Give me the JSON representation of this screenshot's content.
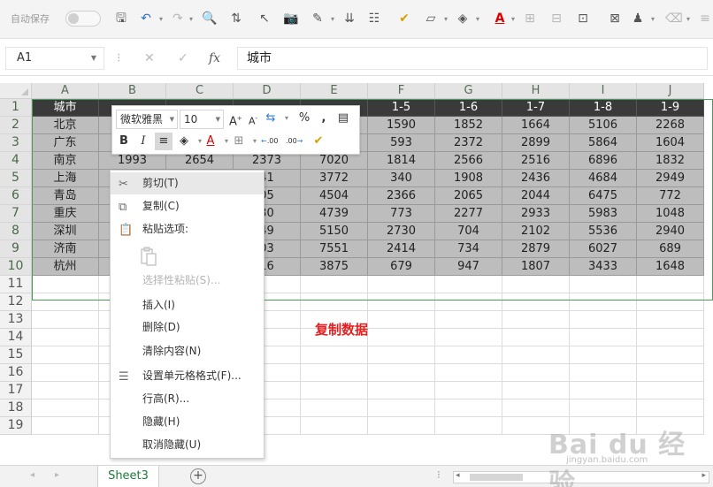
{
  "toolbar": {
    "autosave_label": "自动保存"
  },
  "formula_bar": {
    "name_box": "A1",
    "fx": "fx",
    "value": "城市"
  },
  "columns": [
    "A",
    "B",
    "C",
    "D",
    "E",
    "F",
    "G",
    "H",
    "I",
    "J"
  ],
  "rows": [
    "1",
    "2",
    "3",
    "4",
    "5",
    "6",
    "7",
    "8",
    "9",
    "10",
    "11",
    "12",
    "13",
    "14",
    "15",
    "16",
    "17",
    "18",
    "19"
  ],
  "cells": [
    [
      "城市",
      "",
      "",
      "",
      "",
      "1-5",
      "1-6",
      "1-7",
      "1-8",
      "1-9"
    ],
    [
      "北京",
      "",
      "",
      "",
      "",
      "1590",
      "1852",
      "1664",
      "5106",
      "2268"
    ],
    [
      "广东",
      "",
      "",
      "",
      "",
      "593",
      "2372",
      "2899",
      "5864",
      "1604"
    ],
    [
      "南京",
      "1993",
      "2654",
      "2373",
      "7020",
      "1814",
      "2566",
      "2516",
      "6896",
      "1832"
    ],
    [
      "上海",
      "",
      "",
      "41",
      "3772",
      "340",
      "1908",
      "2436",
      "4684",
      "2949"
    ],
    [
      "青岛",
      "",
      "",
      "05",
      "4504",
      "2366",
      "2065",
      "2044",
      "6475",
      "772"
    ],
    [
      "重庆",
      "",
      "",
      "30",
      "4739",
      "773",
      "2277",
      "2933",
      "5983",
      "1048"
    ],
    [
      "深圳",
      "",
      "",
      "49",
      "5150",
      "2730",
      "704",
      "2102",
      "5536",
      "2940"
    ],
    [
      "济南",
      "",
      "",
      "03",
      "7551",
      "2414",
      "734",
      "2879",
      "6027",
      "689"
    ],
    [
      "杭州",
      "",
      "",
      "16",
      "3875",
      "679",
      "947",
      "1807",
      "3433",
      "1648"
    ]
  ],
  "mini_toolbar": {
    "font_name": "微软雅黑",
    "font_size": "10",
    "grow_font": "A",
    "shrink_font": "A",
    "percent": "%",
    "comma": ",",
    "bold": "B",
    "italic": "I",
    "font_color": "A",
    "inc_decimal": ".00",
    "dec_decimal": ".00"
  },
  "context_menu": {
    "items": [
      {
        "label": "剪切(T)",
        "state": "hover"
      },
      {
        "label": "复制(C)",
        "state": "normal"
      },
      {
        "label": "粘贴选项:",
        "state": "normal"
      },
      {
        "label": "选择性粘贴(S)...",
        "state": "disabled"
      },
      {
        "label": "插入(I)",
        "state": "normal"
      },
      {
        "label": "删除(D)",
        "state": "normal"
      },
      {
        "label": "清除内容(N)",
        "state": "normal"
      },
      {
        "label": "设置单元格格式(F)...",
        "state": "normal"
      },
      {
        "label": "行高(R)...",
        "state": "normal"
      },
      {
        "label": "隐藏(H)",
        "state": "normal"
      },
      {
        "label": "取消隐藏(U)",
        "state": "normal"
      }
    ]
  },
  "annotation": "复制数据",
  "sheet_bar": {
    "sheet_name": "Sheet3",
    "add_sheet": "+"
  },
  "watermark": {
    "brand": "Bai du 经验",
    "url": "jingyan.baidu.com"
  },
  "colors": {
    "selection_border": "#4c9a5a",
    "header_fill": "#3a3a3a",
    "selection_fill": "#bdbdbd",
    "annotation": "#e62020",
    "sheet_tab_text": "#1f7a3a"
  }
}
